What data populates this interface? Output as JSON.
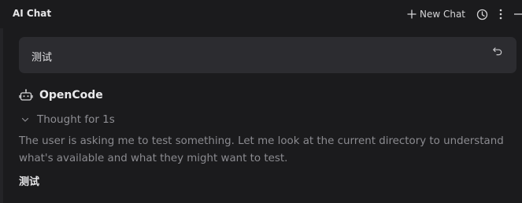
{
  "header": {
    "title": "AI Chat",
    "new_chat_label": "New Chat"
  },
  "icons": {
    "new_chat": "plus-icon",
    "history": "history-clock-icon",
    "more": "more-vertical-icon",
    "minimize": "minimize-icon",
    "revert": "undo-icon",
    "agent": "robot-icon",
    "thought_toggle": "chevron-down-icon"
  },
  "conversation": {
    "user_message": "测试",
    "agent_name": "OpenCode",
    "thought_label": "Thought for 1s",
    "thought_text": "The user is asking me to test something. Let me look at the current directory to understand what's available and what they might want to test.",
    "answer_text": "测试"
  },
  "colors": {
    "background": "#1b1b1d",
    "user_bubble": "#2c2c30",
    "muted_text": "#8b8b90",
    "primary_text": "#e6e6e8"
  }
}
